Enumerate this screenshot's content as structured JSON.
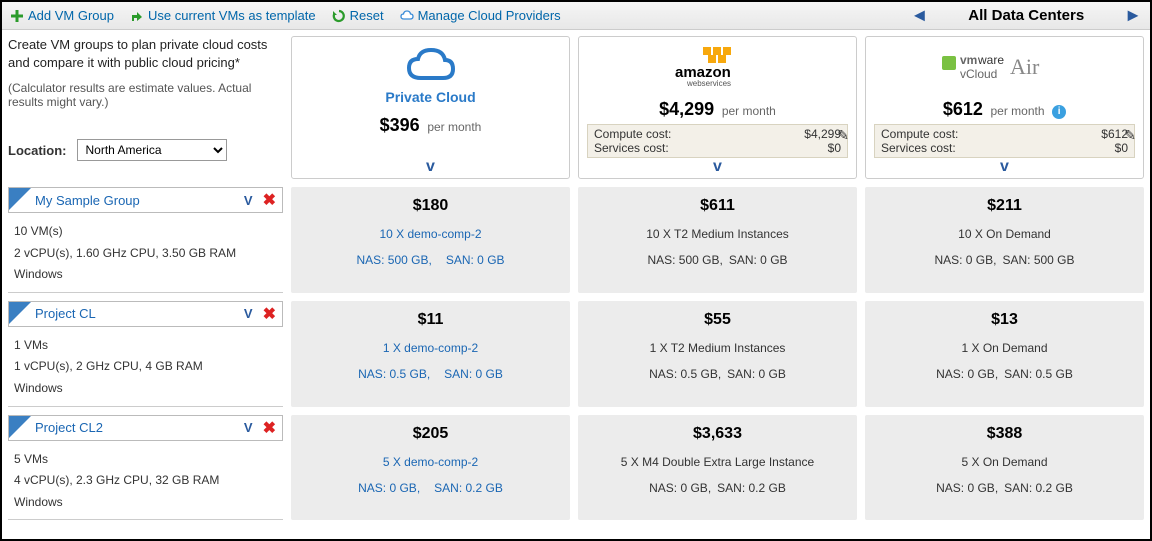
{
  "toolbar": {
    "add_group": "Add VM Group",
    "use_template": "Use current VMs as template",
    "reset": "Reset",
    "manage_cloud": "Manage Cloud Providers"
  },
  "dc_nav": {
    "title": "All Data Centers"
  },
  "intro": {
    "text": "Create VM groups to plan private cloud costs and compare it with public cloud pricing*",
    "sub": "(Calculator results are estimate values. Actual results might vary.)"
  },
  "location": {
    "label": "Location:",
    "value": "North America"
  },
  "providers": [
    {
      "name": "Private Cloud",
      "price": "$396",
      "per": "per month",
      "show_costbox": false,
      "show_info": false
    },
    {
      "name": "amazon webservices",
      "price": "$4,299",
      "per": "per month",
      "show_costbox": true,
      "show_info": false,
      "compute_label": "Compute cost:",
      "compute_val": "$4,299",
      "services_label": "Services cost:",
      "services_val": "$0"
    },
    {
      "name": "vmware vCloud Air",
      "price": "$612",
      "per": "per month",
      "show_costbox": true,
      "show_info": true,
      "compute_label": "Compute cost:",
      "compute_val": "$612",
      "services_label": "Services cost:",
      "services_val": "$0"
    }
  ],
  "groups": [
    {
      "name": "My Sample Group",
      "vms": "10 VM(s)",
      "spec": "2 vCPU(s), 1.60 GHz CPU, 3.50 GB RAM",
      "os": "Windows",
      "cells": [
        {
          "price": "$180",
          "line": "10 X demo-comp-2",
          "nas": "NAS: 500 GB,",
          "san": "SAN: 0 GB",
          "link_style": true
        },
        {
          "price": "$611",
          "line": "10 X T2 Medium Instances",
          "nas": "NAS: 500 GB,",
          "san": "SAN: 0 GB",
          "link_style": false
        },
        {
          "price": "$211",
          "line": "10 X On Demand",
          "nas": "NAS: 0 GB,",
          "san": "SAN: 500 GB",
          "link_style": false
        }
      ]
    },
    {
      "name": "Project CL",
      "vms": "1 VMs",
      "spec": "1 vCPU(s), 2 GHz CPU, 4 GB RAM",
      "os": "Windows",
      "cells": [
        {
          "price": "$11",
          "line": "1 X demo-comp-2",
          "nas": "NAS: 0.5 GB,",
          "san": "SAN: 0 GB",
          "link_style": true
        },
        {
          "price": "$55",
          "line": "1 X T2 Medium Instances",
          "nas": "NAS: 0.5 GB,",
          "san": "SAN: 0 GB",
          "link_style": false
        },
        {
          "price": "$13",
          "line": "1 X On Demand",
          "nas": "NAS: 0 GB,",
          "san": "SAN: 0.5 GB",
          "link_style": false
        }
      ]
    },
    {
      "name": "Project CL2",
      "vms": "5 VMs",
      "spec": "4 vCPU(s), 2.3 GHz CPU, 32 GB RAM",
      "os": "Windows",
      "cells": [
        {
          "price": "$205",
          "line": "5 X demo-comp-2",
          "nas": "NAS: 0 GB,",
          "san": "SAN: 0.2 GB",
          "link_style": true
        },
        {
          "price": "$3,633",
          "line": "5 X M4 Double Extra Large Instance",
          "nas": "NAS: 0 GB,",
          "san": "SAN: 0.2 GB",
          "link_style": false
        },
        {
          "price": "$388",
          "line": "5 X On Demand",
          "nas": "NAS: 0 GB,",
          "san": "SAN: 0.2 GB",
          "link_style": false
        }
      ]
    }
  ]
}
